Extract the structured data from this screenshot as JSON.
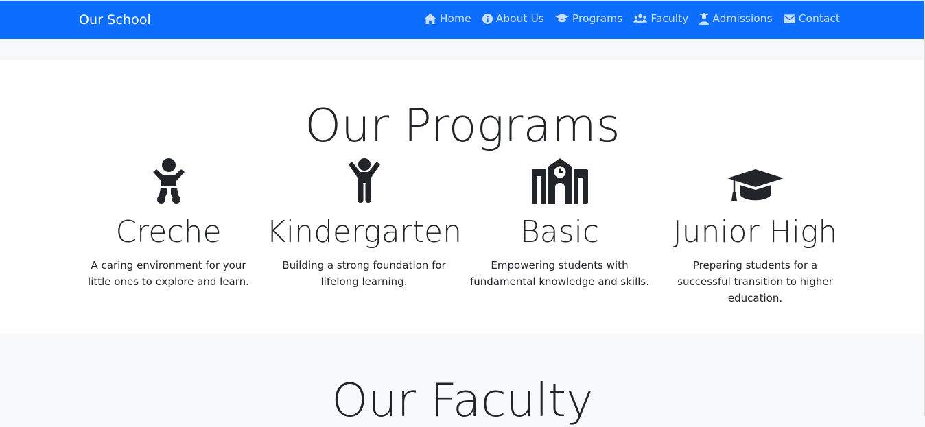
{
  "navbar": {
    "brand": "Our School",
    "links": [
      {
        "label": "Home",
        "icon": "home-icon"
      },
      {
        "label": "About Us",
        "icon": "info-circle-icon"
      },
      {
        "label": "Programs",
        "icon": "graduation-cap-icon"
      },
      {
        "label": "Faculty",
        "icon": "users-icon"
      },
      {
        "label": "Admissions",
        "icon": "user-graduate-icon"
      },
      {
        "label": "Contact",
        "icon": "envelope-icon"
      }
    ]
  },
  "programs": {
    "title": "Our Programs",
    "items": [
      {
        "name": "Creche",
        "description": "A caring environment for your little ones to explore and learn.",
        "icon": "baby-icon"
      },
      {
        "name": "Kindergarten",
        "description": "Building a strong foundation for lifelong learning.",
        "icon": "child-icon"
      },
      {
        "name": "Basic",
        "description": "Empowering students with fundamental knowledge and skills.",
        "icon": "school-icon"
      },
      {
        "name": "Junior High",
        "description": "Preparing students for a successful transition to higher education.",
        "icon": "graduation-cap-icon"
      }
    ]
  },
  "faculty": {
    "title": "Our Faculty"
  },
  "colors": {
    "navbar_bg": "#0d6efd",
    "page_bg": "#f8f9fa",
    "text": "#212529"
  }
}
